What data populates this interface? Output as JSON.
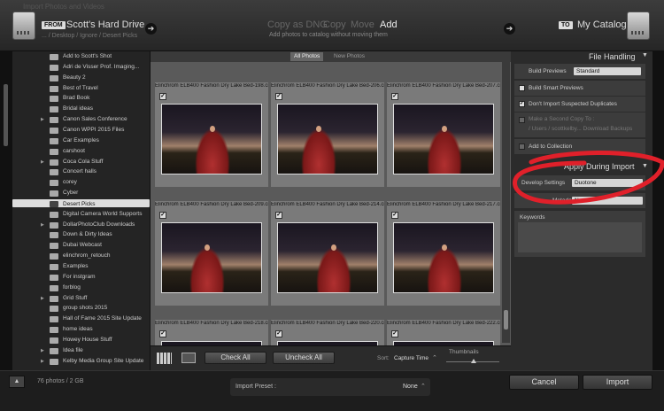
{
  "window": {
    "title": "Import Photos and Videos"
  },
  "header": {
    "from_tag": "FROM",
    "source_name": "Scott's Hard Drive",
    "source_path": "... / Desktop / Ignore / Desert Picks",
    "modes": [
      "Copy as DNG",
      "Copy",
      "Move",
      "Add"
    ],
    "active_mode": "Add",
    "mode_subtitle": "Add photos to catalog without moving them",
    "to_tag": "TO",
    "dest_name": "My Catalog"
  },
  "folders": [
    {
      "name": "Add to Scott's Shot",
      "expand": false
    },
    {
      "name": "Adri de Visser Prof. Imaging...",
      "expand": false
    },
    {
      "name": "Beauty 2",
      "expand": false
    },
    {
      "name": "Best of Travel",
      "expand": false
    },
    {
      "name": "Brad Book",
      "expand": false
    },
    {
      "name": "Bridal ideas",
      "expand": false
    },
    {
      "name": "Canon Sales Conference",
      "expand": true
    },
    {
      "name": "Canon WPPI 2015 Files",
      "expand": false
    },
    {
      "name": "Car Examples",
      "expand": false
    },
    {
      "name": "carshoot",
      "expand": false
    },
    {
      "name": "Coca Cola Stuff",
      "expand": true
    },
    {
      "name": "Concert halls",
      "expand": false
    },
    {
      "name": "corey",
      "expand": false
    },
    {
      "name": "Cyber",
      "expand": false
    },
    {
      "name": "Desert Picks",
      "expand": false,
      "selected": true
    },
    {
      "name": "Digital Camera World Supports",
      "expand": false
    },
    {
      "name": "DollarPhotoClub Downloads",
      "expand": true
    },
    {
      "name": "Down & Dirty Ideas",
      "expand": false
    },
    {
      "name": "Dubai Webcast",
      "expand": false
    },
    {
      "name": "elinchrom_retouch",
      "expand": false
    },
    {
      "name": "Examples",
      "expand": false
    },
    {
      "name": "For instgram",
      "expand": false
    },
    {
      "name": "forblog",
      "expand": false
    },
    {
      "name": "Grid Stuff",
      "expand": true
    },
    {
      "name": "group shots 2015",
      "expand": false
    },
    {
      "name": "Hall of Fame 2015 Site Update",
      "expand": false
    },
    {
      "name": "home ideas",
      "expand": false
    },
    {
      "name": "Howey House Stuff",
      "expand": false
    },
    {
      "name": "Idea file",
      "expand": true
    },
    {
      "name": "Kelby Media Group Site Update",
      "expand": true
    }
  ],
  "grid": {
    "tabs": [
      "All Photos",
      "New Photos"
    ],
    "active_tab": "All Photos",
    "photos": [
      {
        "filename": "Elinchrom ELB400 Fashion Dry Lake Bed-198.cr2",
        "checked": true
      },
      {
        "filename": "Elinchrom ELB400 Fashion Dry Lake Bed-206.cr2",
        "checked": true
      },
      {
        "filename": "Elinchrom ELB400 Fashion Dry Lake Bed-207.cr2",
        "checked": true
      },
      {
        "filename": "Elinchrom ELB400 Fashion Dry Lake Bed-209.cr2",
        "checked": true
      },
      {
        "filename": "Elinchrom ELB400 Fashion Dry Lake Bed-214.cr2",
        "checked": true
      },
      {
        "filename": "Elinchrom ELB400 Fashion Dry Lake Bed-217.cr2",
        "checked": true
      },
      {
        "filename": "Elinchrom ELB400 Fashion Dry Lake Bed-218.cr2",
        "checked": true
      },
      {
        "filename": "Elinchrom ELB400 Fashion Dry Lake Bed-220.cr2",
        "checked": true
      },
      {
        "filename": "Elinchrom ELB400 Fashion Dry Lake Bed-222.cr2",
        "checked": true
      }
    ]
  },
  "toolbar": {
    "check_all": "Check All",
    "uncheck_all": "Uncheck All",
    "sort_label": "Sort:",
    "sort_value": "Capture Time",
    "thumbnails_label": "Thumbnails"
  },
  "right_panel": {
    "file_handling": "File Handling",
    "build_previews_label": "Build Previews",
    "build_previews_value": "Standard",
    "build_smart_previews": "Build Smart Previews",
    "dont_import_duplicates": "Don't Import Suspected Duplicates",
    "second_copy_label": "Make a Second Copy To :",
    "second_copy_path": "/ Users / scottkelby... Download Backups",
    "add_to_collection": "Add to Collection",
    "apply_during_import": "Apply During Import",
    "develop_settings_label": "Develop Settings",
    "develop_settings_value": "Duotone",
    "metadata_label": "Metadata",
    "metadata_value": "None",
    "keywords_label": "Keywords"
  },
  "footer": {
    "photo_count": "76 photos / 2 GB",
    "import_preset_label": "Import Preset :",
    "import_preset_value": "None",
    "cancel": "Cancel",
    "import": "Import"
  },
  "colors": {
    "annotation": "#e0202a",
    "selected_folder": "#dddddd"
  }
}
